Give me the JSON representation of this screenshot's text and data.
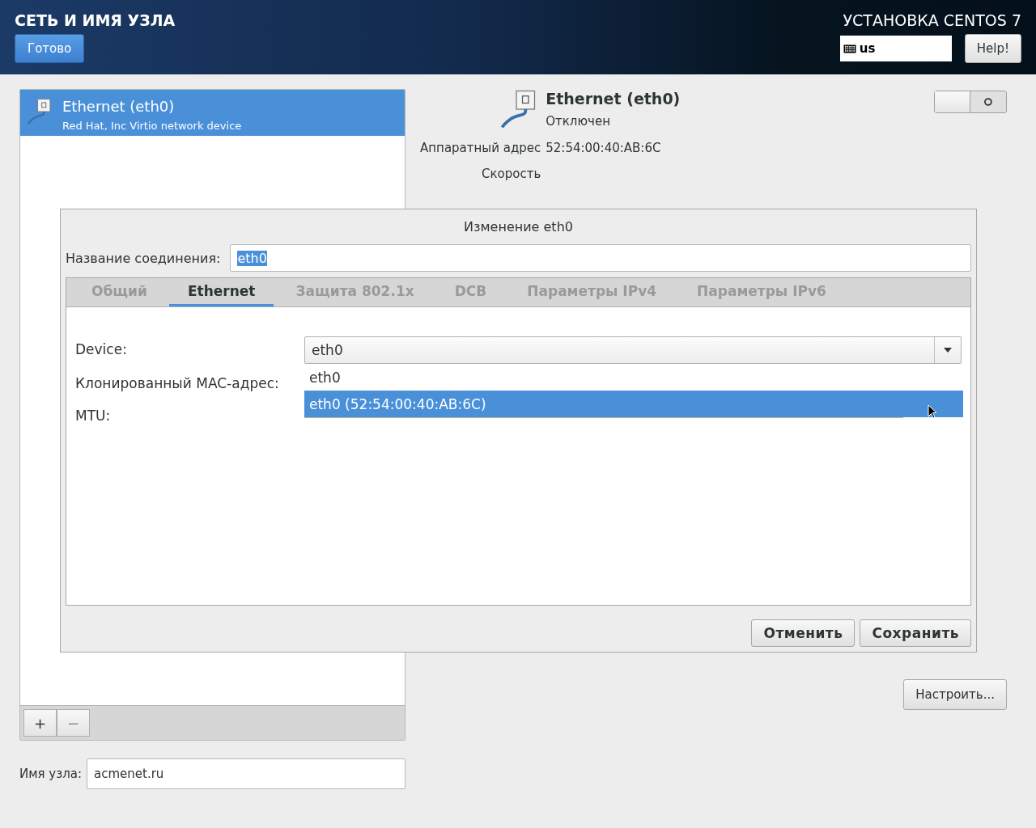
{
  "header": {
    "title": "СЕТЬ И ИМЯ УЗЛА",
    "done_button": "Готово",
    "product": "УСТАНОВКА CENTOS 7",
    "keyboard_layout": "us",
    "help_button": "Help!"
  },
  "devices": [
    {
      "name": "Ethernet (eth0)",
      "description": "Red Hat, Inc Virtio network device",
      "selected": true
    }
  ],
  "list_buttons": [
    "+",
    "−"
  ],
  "details": {
    "name": "Ethernet (eth0)",
    "status": "Отключен",
    "fields": [
      {
        "label": "Аппаратный адрес",
        "value": "52:54:00:40:AB:6C"
      },
      {
        "label": "Скорость"
      }
    ],
    "switch_on": false,
    "configure_button": "Настроить..."
  },
  "hostname": {
    "label": "Имя узла:",
    "value": "acmenet.ru"
  },
  "dialog": {
    "title": "Изменение eth0",
    "connection_name_label": "Название соединения:",
    "connection_name": "eth0",
    "connection_name_selected": true,
    "tabs": [
      {
        "label": "Общий",
        "selected": false
      },
      {
        "label": "Ethernet",
        "selected": true
      },
      {
        "label": "Защита 802.1x",
        "selected": false
      },
      {
        "label": "DCB",
        "selected": false
      },
      {
        "label": "Параметры IPv4",
        "selected": false
      },
      {
        "label": "Параметры IPv6",
        "selected": false
      }
    ],
    "rows": [
      {
        "label": "Device:"
      },
      {
        "label": "Клонированный MAC-адрес:"
      },
      {
        "label": "MTU:"
      }
    ],
    "device_value": "eth0",
    "dropdown_options": [
      {
        "label": "eth0",
        "selected": false
      },
      {
        "label": "eth0 (52:54:00:40:AB:6C)",
        "selected": true
      }
    ],
    "buttons": [
      "Отменить",
      "Сохранить"
    ]
  }
}
